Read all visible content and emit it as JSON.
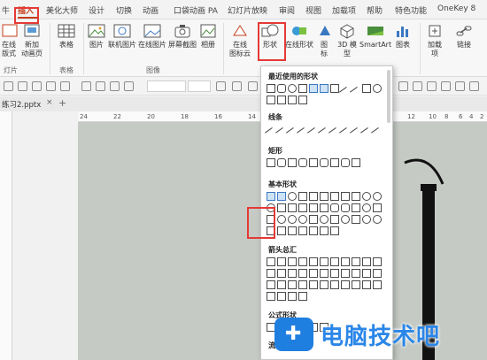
{
  "menu": {
    "tabs": [
      "插入",
      "美化大师",
      "设计",
      "切换",
      "动画",
      "口袋动画 PA",
      "幻灯片放映",
      "审阅",
      "视图",
      "加载项",
      "帮助",
      "特色功能",
      "OneKey 8"
    ],
    "active": "插入"
  },
  "ribbon": {
    "buttons": {
      "new_slide": "在线\n版式",
      "new_anim": "新加\n动画页",
      "table": "表格",
      "picture": "图片",
      "online_picture": "联机图片",
      "online_picture2": "在线图片",
      "screenshot": "屏幕截图",
      "album": "相册",
      "online_icon": "在线\n图标云",
      "shapes": "形状",
      "online_shapes": "在线形状",
      "icons": "图\n标",
      "model3d": "3D 模\n型",
      "smartart": "SmartArt",
      "chart": "图表",
      "addin": "加载\n项",
      "link": "链接"
    },
    "groups": {
      "slides": "灯片",
      "tables": "表格",
      "images": "图像"
    }
  },
  "document": {
    "tab_name": "练习2.pptx",
    "close": "×",
    "add": "+"
  },
  "ruler": {
    "ticks": [
      "24",
      "22",
      "20",
      "18",
      "16",
      "14",
      "12",
      "10",
      "8",
      "6",
      "4",
      "2"
    ]
  },
  "shapes_menu": {
    "recent": "最近使用的形状",
    "lines": "线条",
    "rectangles": "矩形",
    "basic": "基本形状",
    "arrows": "箭头总汇",
    "equation": "公式形状",
    "flowchart": "流程图"
  },
  "watermark": {
    "text": "电脑技术吧"
  },
  "colors": {
    "accent": "#c43e1c",
    "highlight": "#e53935",
    "canvas": "#c5cac5",
    "watermark": "#2a86e8"
  }
}
